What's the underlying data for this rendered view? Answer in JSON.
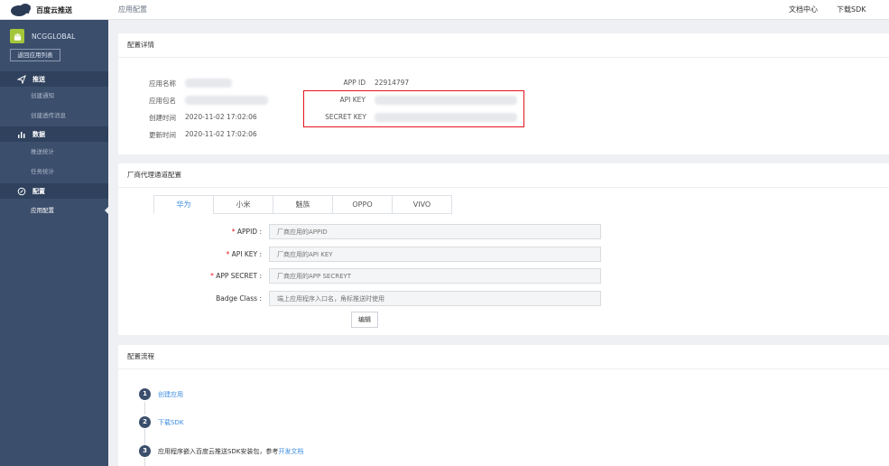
{
  "brand": {
    "name": "百度云推送"
  },
  "breadcrumb": "应用配置",
  "top_links": {
    "docs": "文档中心",
    "sdk": "下载SDK"
  },
  "sidebar": {
    "app_name": "NCGGLOBAL",
    "back_button": "返回应用列表",
    "groups": [
      {
        "label": "推送",
        "icon": "send-icon",
        "items": [
          "创建通知",
          "创建透传消息"
        ]
      },
      {
        "label": "数据",
        "icon": "chart-icon",
        "items": [
          "推送统计",
          "任务统计"
        ]
      },
      {
        "label": "配置",
        "icon": "settings-icon",
        "items": [
          "应用配置"
        ]
      }
    ],
    "active_item": "应用配置"
  },
  "details": {
    "title": "配置详情",
    "app_name_label": "应用名称",
    "package_label": "应用包名",
    "created_label": "创建时间",
    "created_value": "2020-11-02 17:02:06",
    "updated_label": "更新时间",
    "updated_value": "2020-11-02 17:02:06",
    "app_id_label": "APP ID",
    "app_id_value": "22914797",
    "api_key_label": "API KEY",
    "secret_key_label": "SECRET KEY"
  },
  "vendor": {
    "title": "厂商代理通道配置",
    "tabs": [
      "华为",
      "小米",
      "魅族",
      "OPPO",
      "VIVO"
    ],
    "active_tab": "华为",
    "fields": [
      {
        "label": "APPID",
        "required": true,
        "placeholder": "厂商应用的APPID"
      },
      {
        "label": "API KEY",
        "required": true,
        "placeholder": "厂商应用的API KEY"
      },
      {
        "label": "APP SECRET",
        "required": true,
        "placeholder": "厂商应用的APP SECREYT"
      },
      {
        "label": "Badge Class",
        "required": false,
        "placeholder": "端上应用程序入口名，角标推送时使用"
      }
    ],
    "edit_button": "编辑"
  },
  "process": {
    "title": "配置流程",
    "steps": [
      {
        "num": "1",
        "text": "",
        "link": "创建应用"
      },
      {
        "num": "2",
        "text": "",
        "link": "下载SDK"
      },
      {
        "num": "3",
        "text": "应用程序嵌入百度云推送SDK安装包，参考",
        "link": "开发文档"
      }
    ]
  },
  "colors": {
    "sidebar_bg": "#3b4e6c",
    "accent": "#3c8de0",
    "highlight": "#e5141c"
  }
}
